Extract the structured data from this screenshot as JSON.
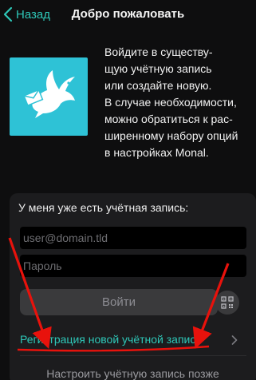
{
  "nav": {
    "back_label": "Назад",
    "title": "Добро пожаловать"
  },
  "intro": {
    "text": "Войдите в существу-\nщую учётную запись\nили создайте новую.\nВ случае необходимости,\nможно обратиться к рас-\nширенному набору опций\nв настройках Monal."
  },
  "login": {
    "heading": "У меня уже есть учётная запись:",
    "user_placeholder": "user@domain.tld",
    "password_placeholder": "Пароль",
    "login_button": "Войти",
    "register_label": "Регистрация новой учётной записи",
    "later_label": "Настроить учётную запись позже"
  },
  "colors": {
    "accent": "#2ec7b8",
    "logo_bg": "#2ec2d6",
    "annotation_arrow": "#e8120c"
  },
  "icons": [
    "chevron-left-icon",
    "dove-letter-icon",
    "qr-code-icon",
    "chevron-right-icon"
  ]
}
